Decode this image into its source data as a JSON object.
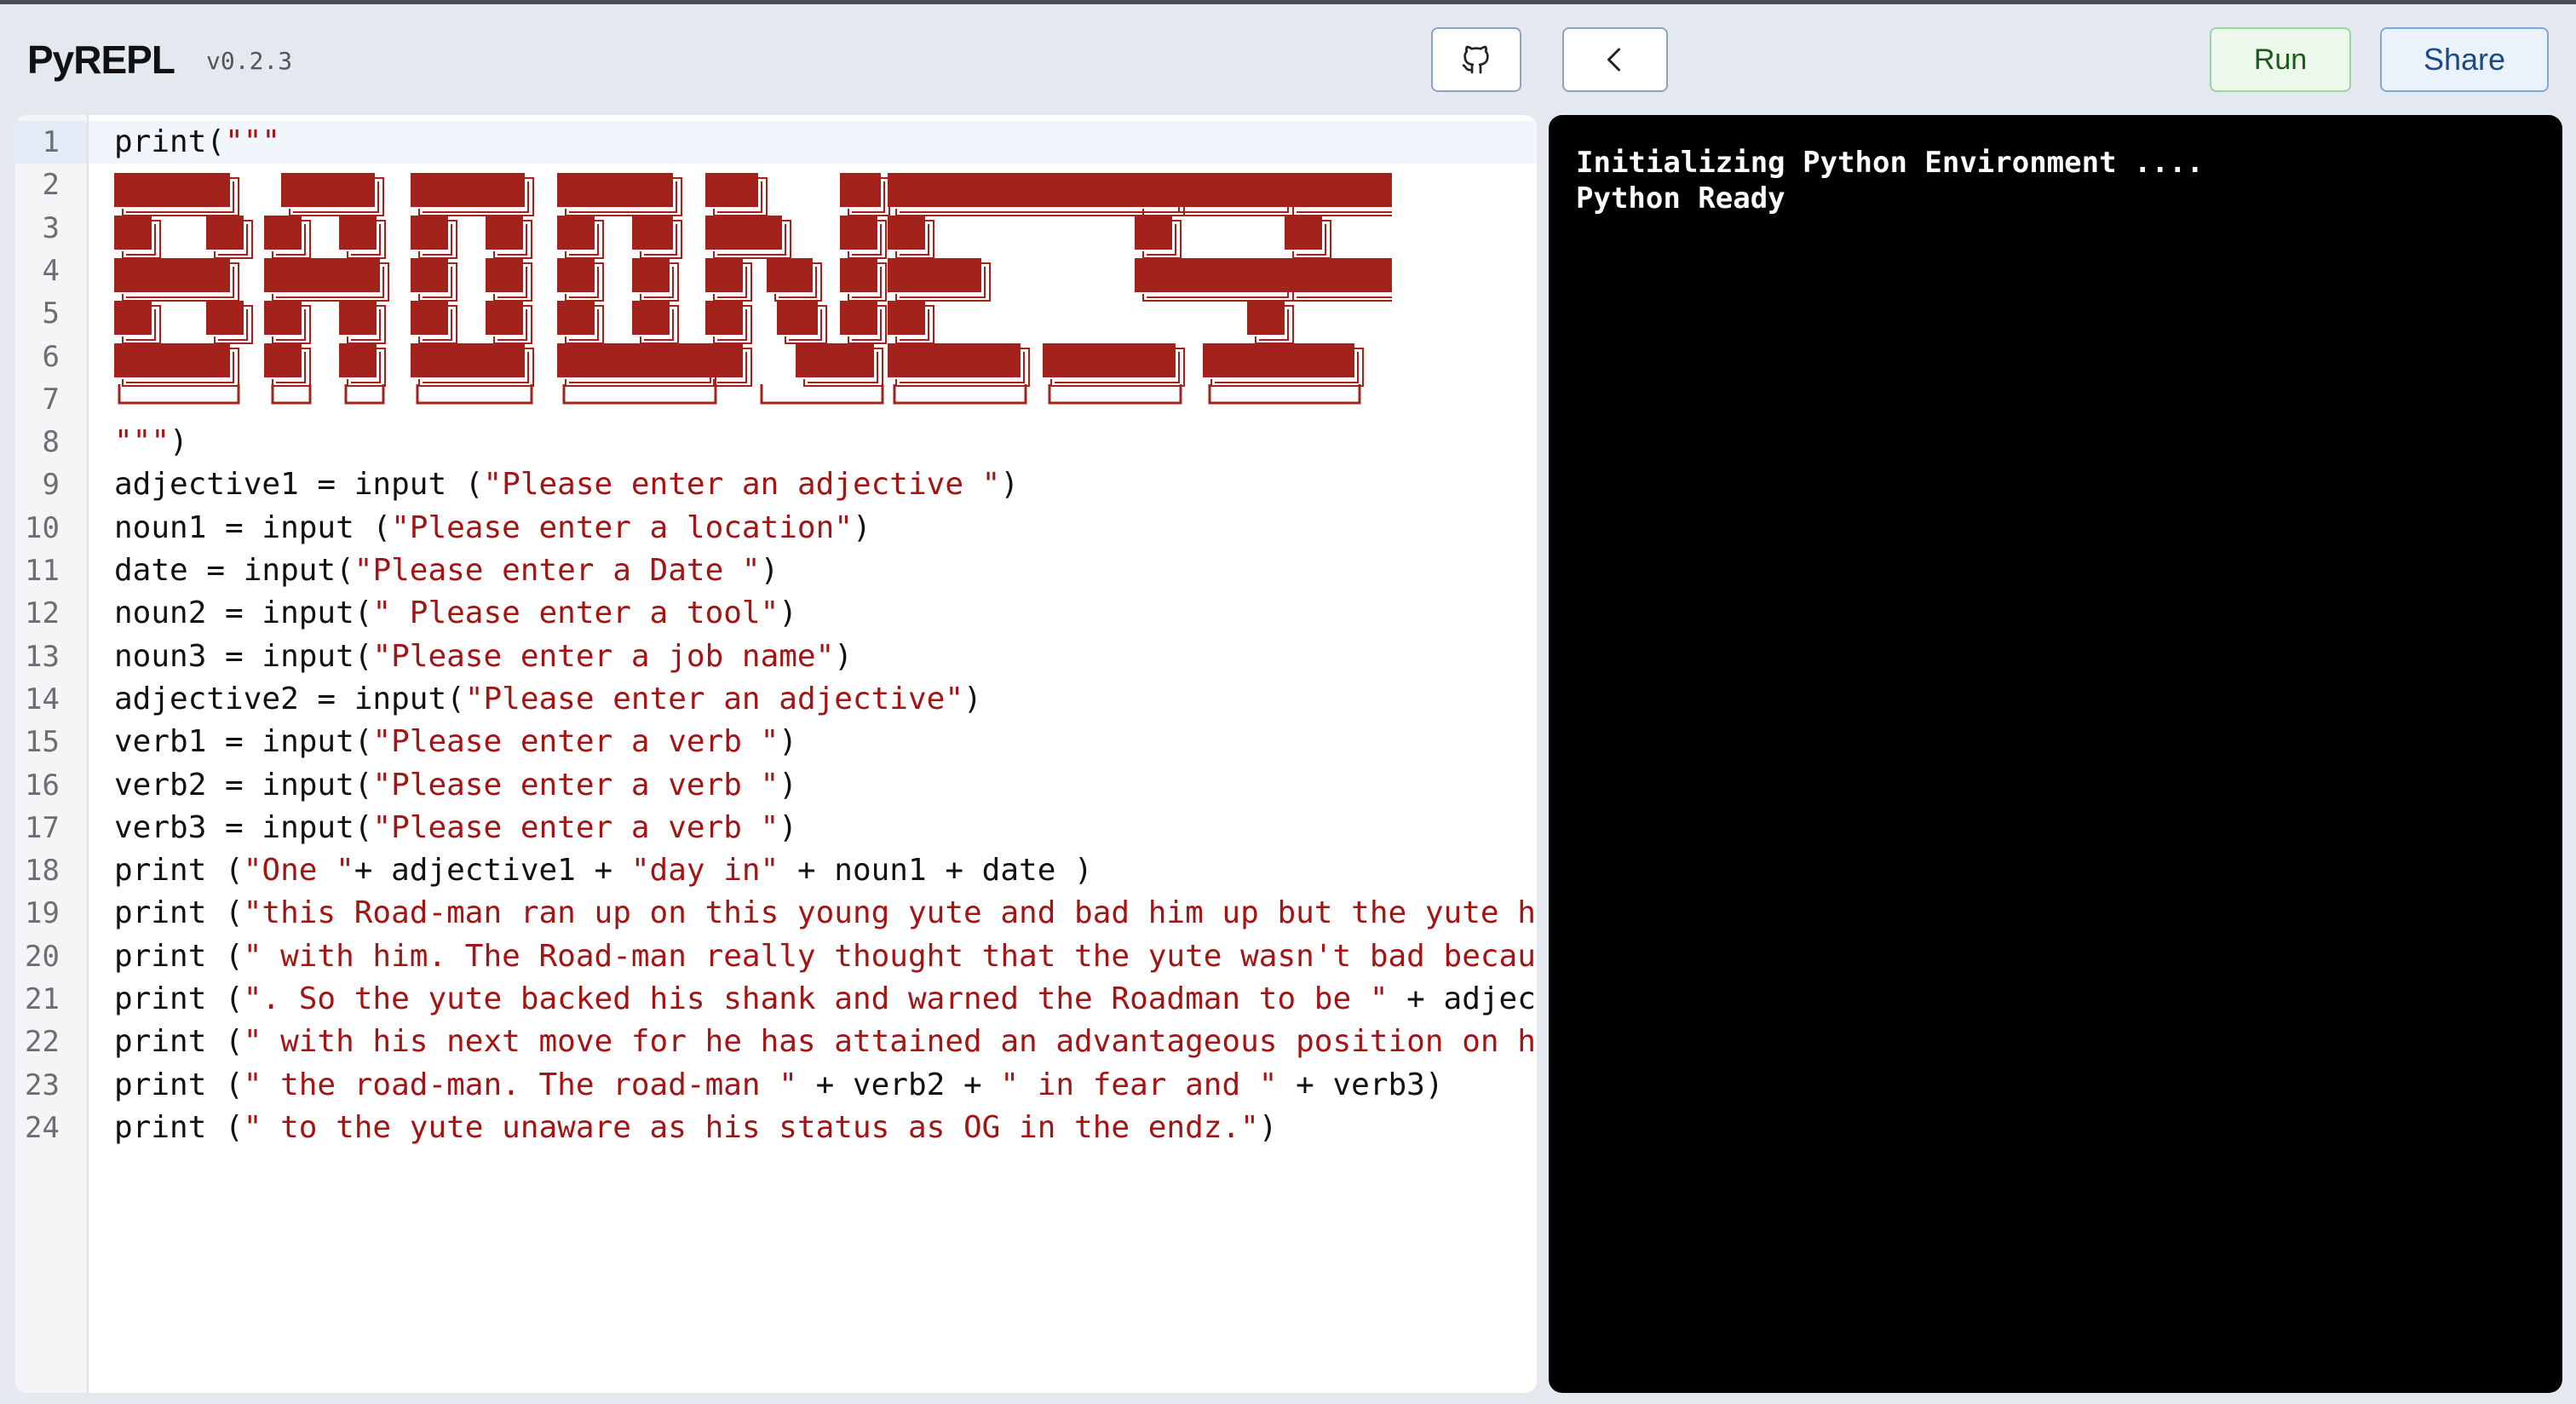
{
  "app": {
    "title": "PyREPL",
    "version": "v0.2.3"
  },
  "toolbar": {
    "run_label": "Run",
    "share_label": "Share"
  },
  "colors": {
    "string": "#a31515",
    "art": "#a4221c",
    "console_bg": "#000000",
    "run_bg": "#ecf8ec",
    "share_bg": "#eaf2fb"
  },
  "icons": {
    "github": "github-icon",
    "back": "chevron-left-icon"
  },
  "editor": {
    "line_numbers": [
      "1",
      "2",
      "3",
      "4",
      "5",
      "6",
      "7",
      "8",
      "9",
      "10",
      "11",
      "12",
      "13",
      "14",
      "15",
      "16",
      "17",
      "18",
      "19",
      "20",
      "21",
      "22",
      "23",
      "24"
    ],
    "lines": [
      [
        {
          "t": "print("
        },
        {
          "t": "\"\"\"",
          "s": 1
        }
      ],
      [],
      [],
      [],
      [],
      [],
      [],
      [
        {
          "t": "\"\"\"",
          "s": 1
        },
        {
          "t": ")"
        }
      ],
      [
        {
          "t": "adjective1 = input ("
        },
        {
          "t": "\"Please enter an adjective \"",
          "s": 1
        },
        {
          "t": ")"
        }
      ],
      [
        {
          "t": "noun1 = input ("
        },
        {
          "t": "\"Please enter a location\"",
          "s": 1
        },
        {
          "t": ")"
        }
      ],
      [
        {
          "t": "date = input("
        },
        {
          "t": "\"Please enter a Date \"",
          "s": 1
        },
        {
          "t": ")"
        }
      ],
      [
        {
          "t": "noun2 = input("
        },
        {
          "t": "\" Please enter a tool\"",
          "s": 1
        },
        {
          "t": ")"
        }
      ],
      [
        {
          "t": "noun3 = input("
        },
        {
          "t": "\"Please enter a job name\"",
          "s": 1
        },
        {
          "t": ")"
        }
      ],
      [
        {
          "t": "adjective2 = input("
        },
        {
          "t": "\"Please enter an adjective\"",
          "s": 1
        },
        {
          "t": ")"
        }
      ],
      [
        {
          "t": "verb1 = input("
        },
        {
          "t": "\"Please enter a verb \"",
          "s": 1
        },
        {
          "t": ")"
        }
      ],
      [
        {
          "t": "verb2 = input("
        },
        {
          "t": "\"Please enter a verb \"",
          "s": 1
        },
        {
          "t": ")"
        }
      ],
      [
        {
          "t": "verb3 = input("
        },
        {
          "t": "\"Please enter a verb \"",
          "s": 1
        },
        {
          "t": ")"
        }
      ],
      [
        {
          "t": "print ("
        },
        {
          "t": "\"One \"",
          "s": 1
        },
        {
          "t": "+ adjective1 + "
        },
        {
          "t": "\"day in\"",
          "s": 1
        },
        {
          "t": " + noun1 + date )"
        }
      ],
      [
        {
          "t": "print ("
        },
        {
          "t": "\"this Road-man ran up on this young yute and bad him up but the yute ha",
          "s": 1
        }
      ],
      [
        {
          "t": "print ("
        },
        {
          "t": "\" with him. The Road-man really thought that the yute wasn't bad becaus",
          "s": 1
        }
      ],
      [
        {
          "t": "print ("
        },
        {
          "t": "\". So the yute backed his shank and warned the Roadman to be \"",
          "s": 1
        },
        {
          "t": " + adject"
        }
      ],
      [
        {
          "t": "print ("
        },
        {
          "t": "\" with his next move for he has attained an advantageous position on hi",
          "s": 1
        }
      ],
      [
        {
          "t": "print ("
        },
        {
          "t": "\" the road-man. The road-man \"",
          "s": 1
        },
        {
          "t": " + verb2 + "
        },
        {
          "t": "\" in fear and \"",
          "s": 1
        },
        {
          "t": " + verb3)"
        }
      ],
      [
        {
          "t": "print ("
        },
        {
          "t": "\" to the yute unaware as his status as OG in the endz.\"",
          "s": 1
        },
        {
          "t": ")"
        }
      ]
    ]
  },
  "console": {
    "lines": [
      "Initializing Python Environment ....",
      "Python Ready"
    ]
  }
}
